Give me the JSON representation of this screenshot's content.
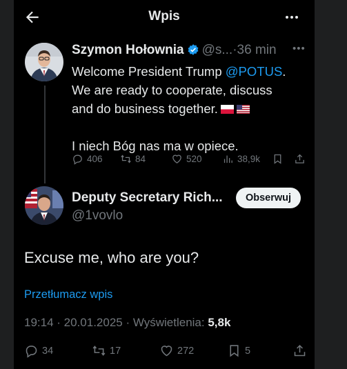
{
  "header": {
    "title": "Wpis",
    "back_icon": "arrow-left-icon",
    "more_icon": "more-horizontal-icon"
  },
  "tweet": {
    "author_name": "Szymon Hołownia",
    "author_handle": "@s...",
    "separator": "·",
    "time": "36 min",
    "verified_color": "#1d9bf0",
    "text_line1_pre": "Welcome President Trump ",
    "mention": "@POTUS",
    "text_line1_post": ".",
    "text_line2": "We are ready to cooperate, discuss",
    "text_line3": "and do business together.",
    "flags": [
      "PL",
      "US"
    ],
    "text_line5": "I niech Bóg nas ma w opiece.",
    "stats": {
      "replies": "406",
      "reposts": "84",
      "likes": "520",
      "views": "38,9k"
    }
  },
  "reply": {
    "author_name": "Deputy Secretary Rich...",
    "author_handle": "@1vovlo",
    "follow_label": "Obserwuj",
    "text": "Excuse me, who are you?",
    "translate_label": "Przetłumacz wpis",
    "meta_time": "19:14 · 20.01.2025 · Wyświetlenia: ",
    "meta_views": "5,8k",
    "stats": {
      "replies": "34",
      "reposts": "17",
      "likes": "272",
      "bookmarks": "5"
    }
  },
  "colors": {
    "accent": "#1d9bf0",
    "muted": "#71767b",
    "text": "#e7e9ea",
    "background": "#000000"
  }
}
